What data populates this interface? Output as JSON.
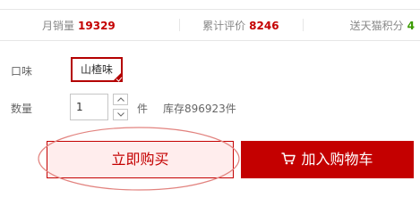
{
  "stats": {
    "monthly_sales_label": "月销量",
    "monthly_sales_value": "19329",
    "total_reviews_label": "累计评价",
    "total_reviews_value": "8246",
    "points_label": "送天猫积分",
    "points_value": "4"
  },
  "flavor": {
    "label": "口味",
    "selected_option": "山楂味"
  },
  "quantity": {
    "label": "数量",
    "value": "1",
    "unit": "件",
    "stock": "库存896923件"
  },
  "actions": {
    "buy_now_label": "立即购买",
    "add_to_cart_label": "加入购物车"
  },
  "colors": {
    "accent": "#c40000",
    "buy_now_bg": "#ffeded",
    "points_green": "#3a9a00"
  }
}
